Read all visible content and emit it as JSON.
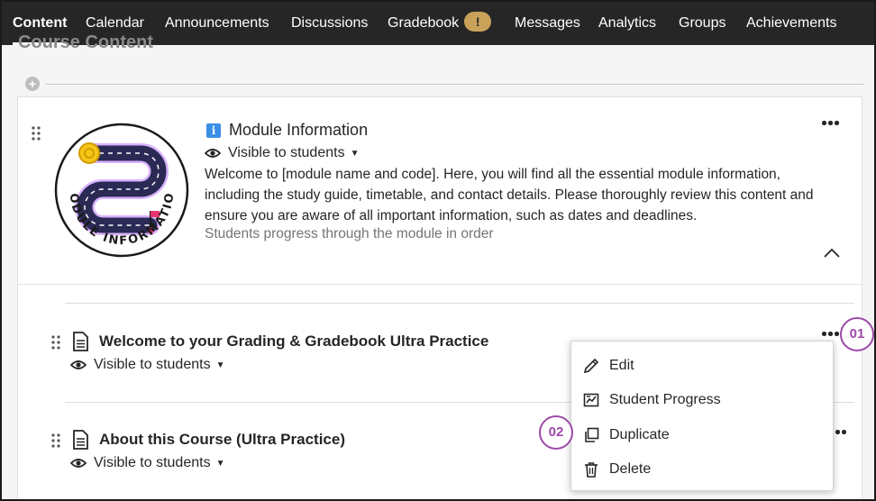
{
  "nav": {
    "items": [
      {
        "label": "Content",
        "active": true
      },
      {
        "label": "Calendar"
      },
      {
        "label": "Announcements"
      },
      {
        "label": "Discussions"
      },
      {
        "label": "Gradebook",
        "badge": "!"
      },
      {
        "label": "Messages"
      },
      {
        "label": "Analytics"
      },
      {
        "label": "Groups"
      },
      {
        "label": "Achievements"
      }
    ],
    "background": "#262626",
    "badge_color": "#c9a25a"
  },
  "page": {
    "title": "Course Content"
  },
  "module": {
    "title": "Module Information",
    "visibility": "Visible to students",
    "description": "Welcome to [module name and code]. Here, you will find all the essential module information, including the study guide, timetable, and contact details. Please thoroughly review this content and ensure you are aware of all important information, such as dates and deadlines.",
    "progress_note": "Students progress through the module in order",
    "logo_text": "MODULE INFORMATION"
  },
  "items": [
    {
      "title": "Welcome to your Grading & Gradebook Ultra Practice",
      "visibility": "Visible to students"
    },
    {
      "title": "About this Course (Ultra Practice)",
      "visibility": "Visible to students"
    }
  ],
  "menu": {
    "items": [
      {
        "label": "Edit",
        "icon": "pencil-icon"
      },
      {
        "label": "Student Progress",
        "icon": "progress-chart-icon"
      },
      {
        "label": "Duplicate",
        "icon": "duplicate-icon"
      },
      {
        "label": "Delete",
        "icon": "trash-icon"
      }
    ]
  },
  "steps": {
    "first": "01",
    "second": "02",
    "color": "#9c4aa8"
  }
}
